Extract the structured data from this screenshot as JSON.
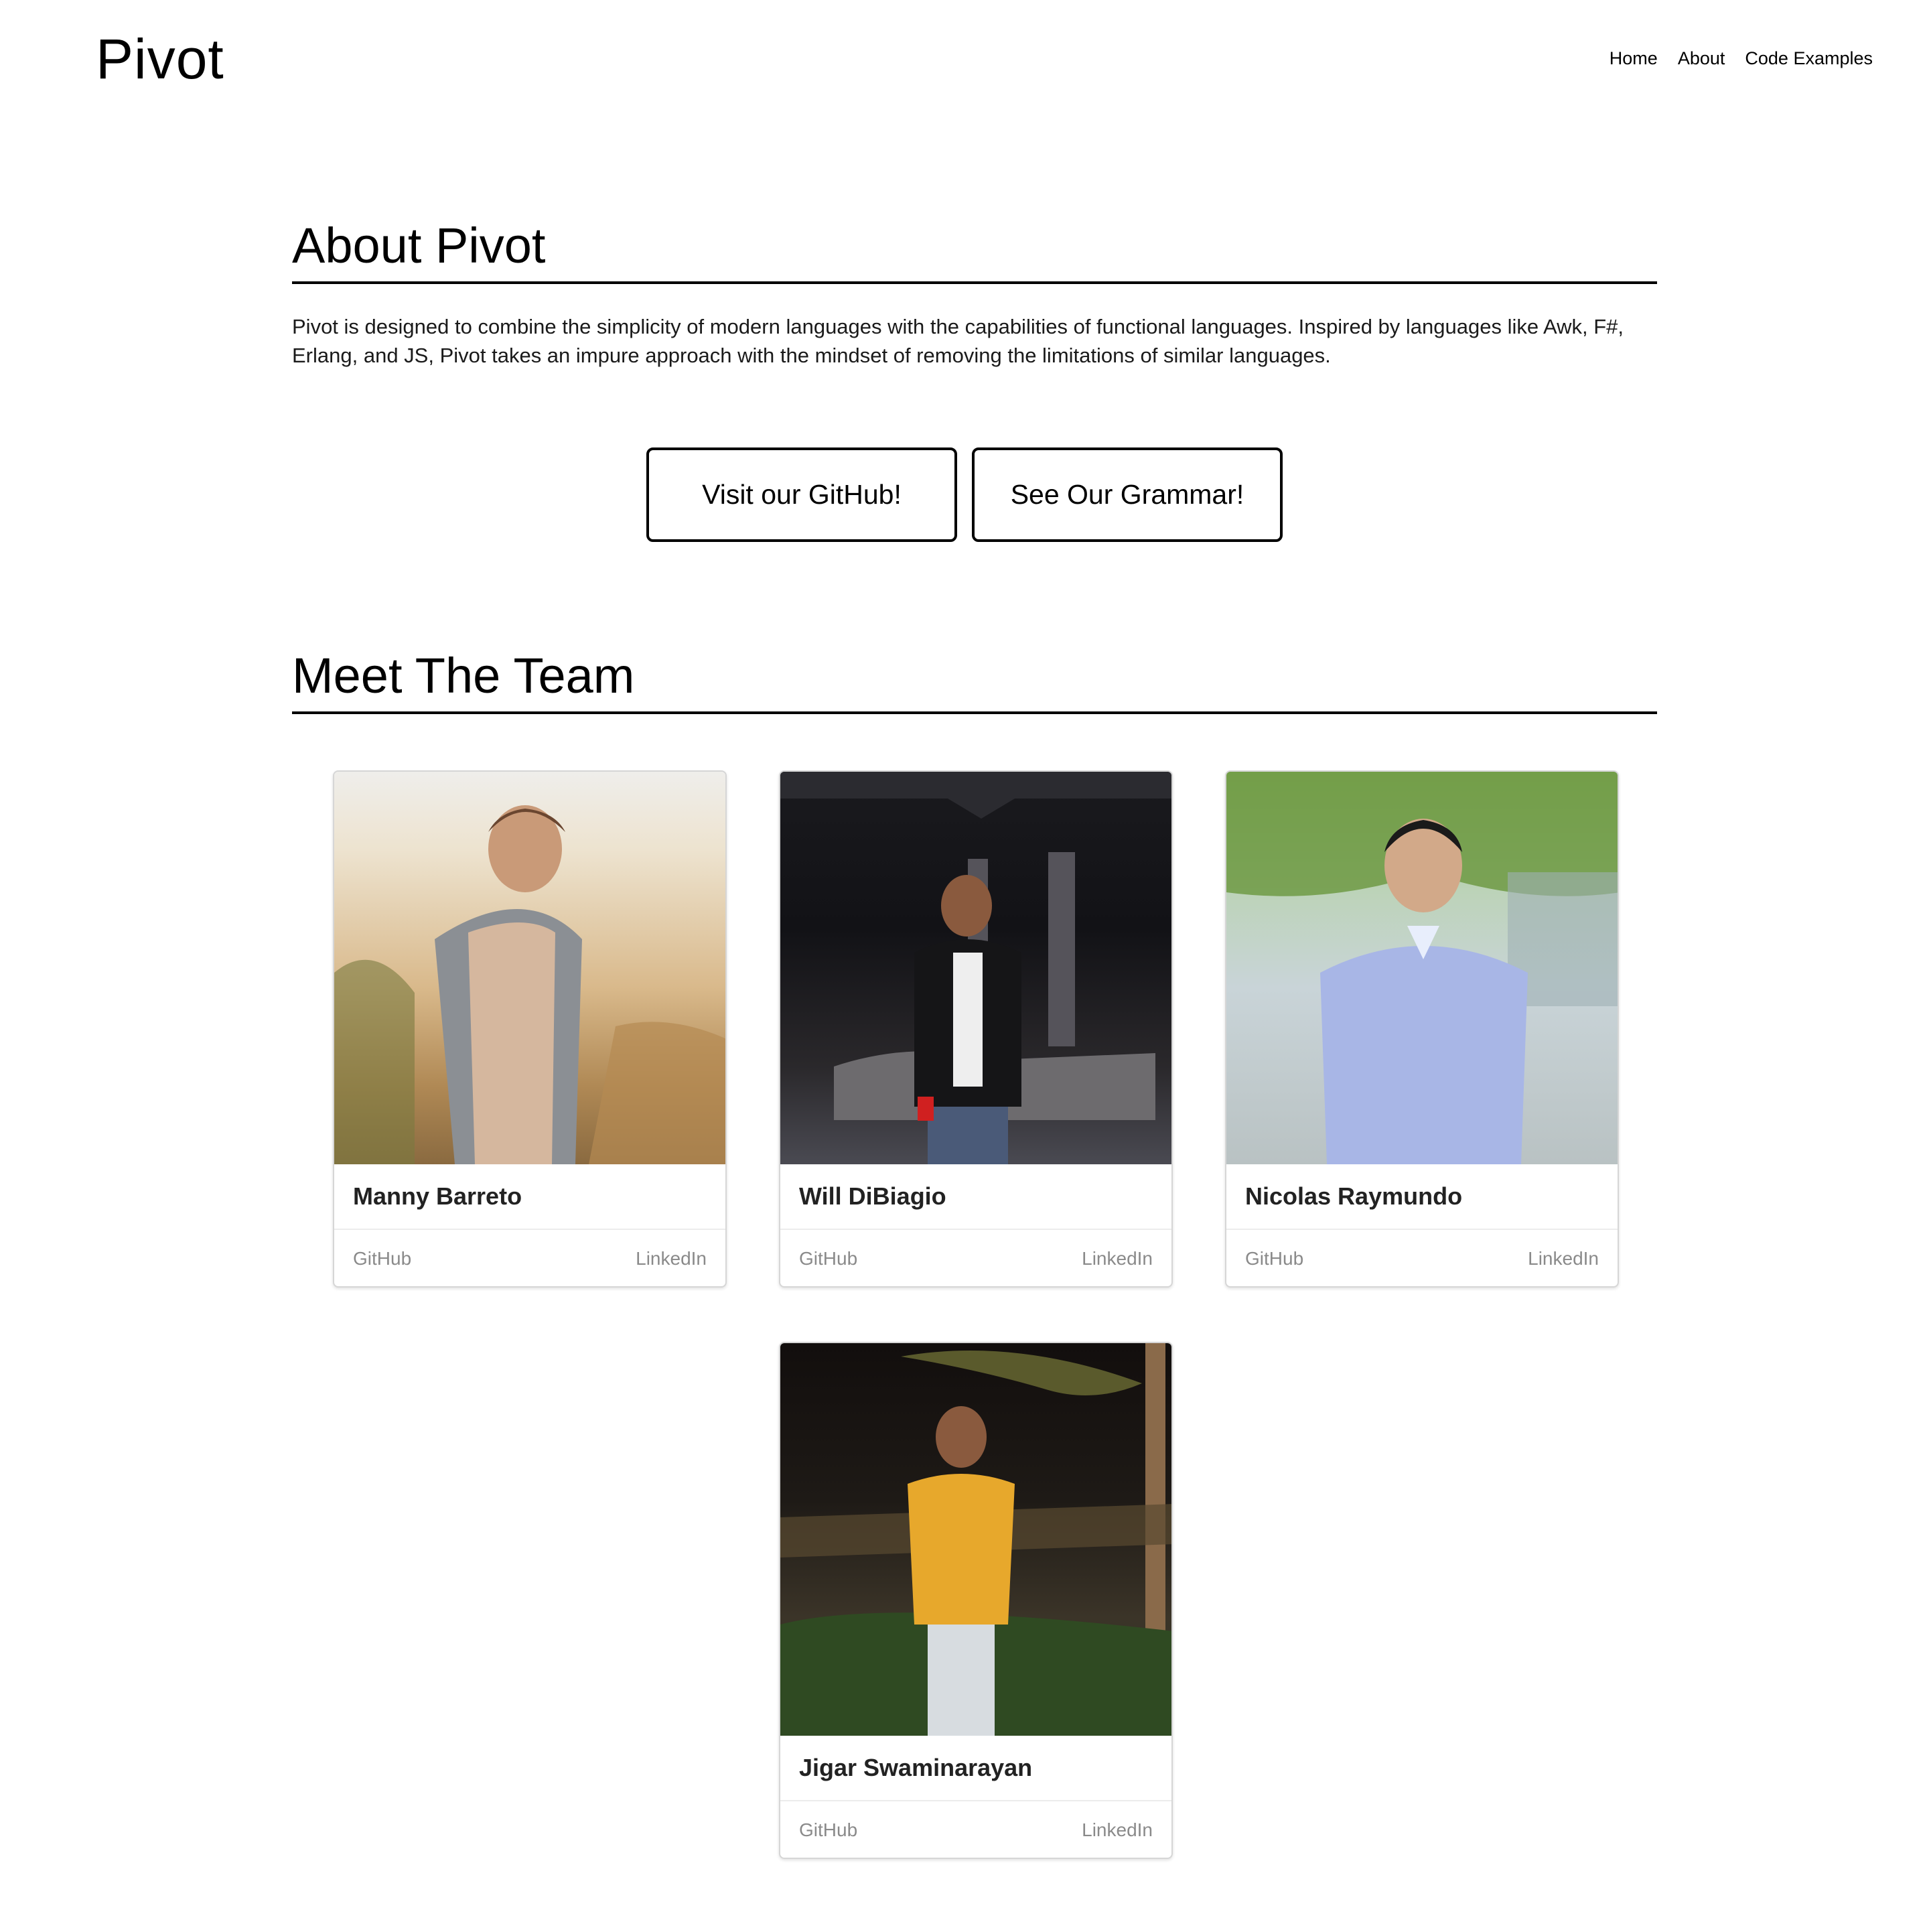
{
  "header": {
    "brand": "Pivot",
    "nav": [
      "Home",
      "About",
      "Code Examples"
    ]
  },
  "about": {
    "title": "About Pivot",
    "description": "Pivot is designed to combine the simplicity of modern languages with the capabilities of functional languages. Inspired by languages like Awk, F#, Erlang, and JS, Pivot takes an impure approach with the mindset of removing the limitations of similar languages.",
    "buttons": [
      "Visit our GitHub!",
      "See Our Grammar!"
    ]
  },
  "team": {
    "title": "Meet The Team",
    "members": [
      {
        "name": "Manny Barreto",
        "github": "GitHub",
        "linkedin": "LinkedIn"
      },
      {
        "name": "Will DiBiagio",
        "github": "GitHub",
        "linkedin": "LinkedIn"
      },
      {
        "name": "Nicolas Raymundo",
        "github": "GitHub",
        "linkedin": "LinkedIn"
      },
      {
        "name": "Jigar Swaminarayan",
        "github": "GitHub",
        "linkedin": "LinkedIn"
      }
    ]
  }
}
